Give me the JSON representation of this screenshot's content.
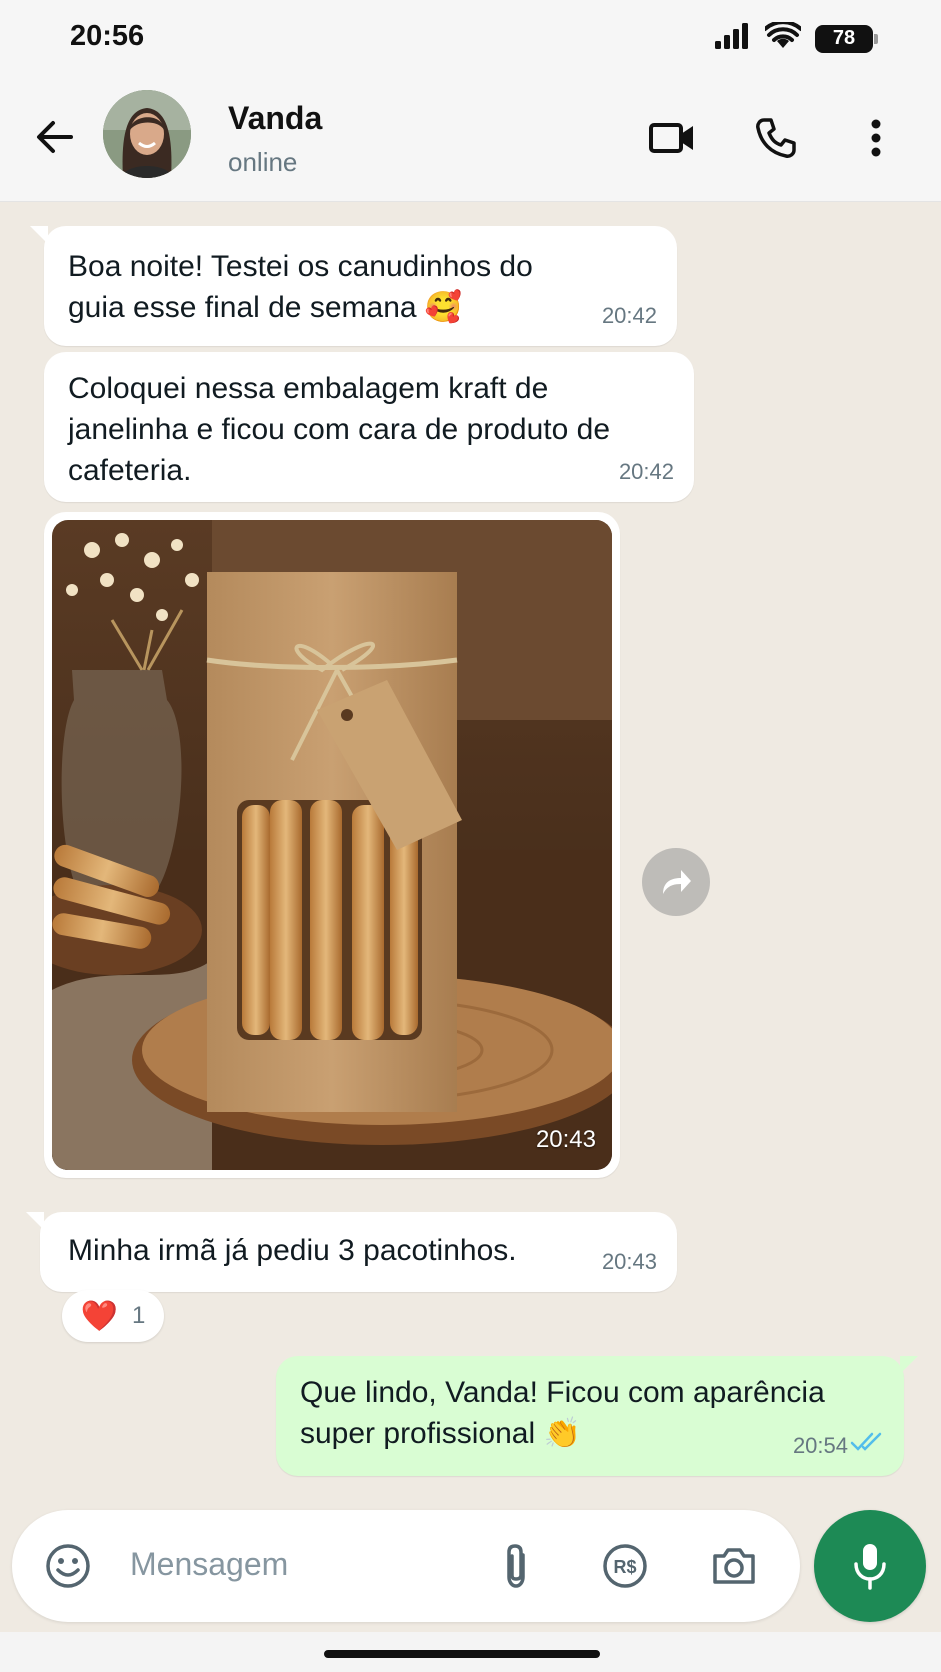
{
  "status_bar": {
    "time": "20:56",
    "battery": "78"
  },
  "header": {
    "contact_name": "Vanda",
    "contact_status": "online"
  },
  "messages": [
    {
      "text": "Boa noite! Testei os canudinhos do guia esse final de semana 🥰",
      "time": "20:42"
    },
    {
      "text": "Coloquei nessa embalagem kraft de janelinha e ficou com cara de produto de cafeteria.",
      "time": "20:42"
    },
    {
      "time": "20:43"
    },
    {
      "text": "Minha irmã já pediu 3 pacotinhos.",
      "time": "20:43",
      "reaction": {
        "emoji": "❤️",
        "count": "1"
      }
    },
    {
      "text": "Que lindo, Vanda! Ficou com aparência super profissional 👏",
      "time": "20:54"
    }
  ],
  "composer": {
    "placeholder": "Mensagem",
    "pay_label": "R$"
  },
  "colors": {
    "outgoing_bubble": "#d9fdd3",
    "incoming_bubble": "#ffffff",
    "chat_bg": "#efeae2",
    "mic_button": "#1d8a55",
    "read_ticks": "#53bdeb"
  }
}
